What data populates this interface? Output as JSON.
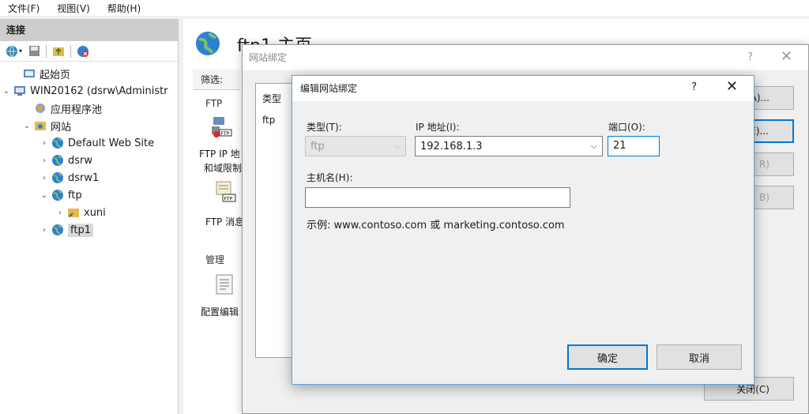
{
  "menu": [
    "文件(F)",
    "视图(V)",
    "帮助(H)"
  ],
  "left_pane": {
    "title": "连接",
    "tree": [
      {
        "label": "起始页",
        "indent": 0
      },
      {
        "label": "WIN20162 (dsrw\\Administr",
        "indent": 0
      },
      {
        "label": "应用程序池",
        "indent": 1
      },
      {
        "label": "网站",
        "indent": 1
      },
      {
        "label": "Default Web Site",
        "indent": 2
      },
      {
        "label": "dsrw",
        "indent": 2
      },
      {
        "label": "dsrw1",
        "indent": 2
      },
      {
        "label": "ftp",
        "indent": 2
      },
      {
        "label": "xuni",
        "indent": 3
      },
      {
        "label": "ftp1",
        "indent": 2
      }
    ]
  },
  "main": {
    "title": "ftp1 主页",
    "filter_label": "筛选:",
    "section_ftp": "FTP",
    "feature1_line1": "FTP IP 地",
    "feature1_line2": "和域限制",
    "feature2": "FTP 消息",
    "section_manage": "管理",
    "feature3": "配置编辑"
  },
  "bindings_dialog": {
    "title": "网站绑定",
    "help": "?",
    "close": "✕",
    "col_type": "类型",
    "row_type": "ftp",
    "btn_add": "A)...",
    "btn_edit": "E)...",
    "btn_remove": "R)",
    "btn_browse": "B)",
    "btn_close": "关闭(C)"
  },
  "edit_dialog": {
    "title": "编辑网站绑定",
    "help": "?",
    "close": "✕",
    "type_label": "类型(T):",
    "type_value": "ftp",
    "ip_label": "IP 地址(I):",
    "ip_value": "192.168.1.3",
    "port_label": "端口(O):",
    "port_value": "21",
    "host_label": "主机名(H):",
    "host_value": "",
    "example": "示例: www.contoso.com 或 marketing.contoso.com",
    "ok": "确定",
    "cancel": "取消"
  }
}
